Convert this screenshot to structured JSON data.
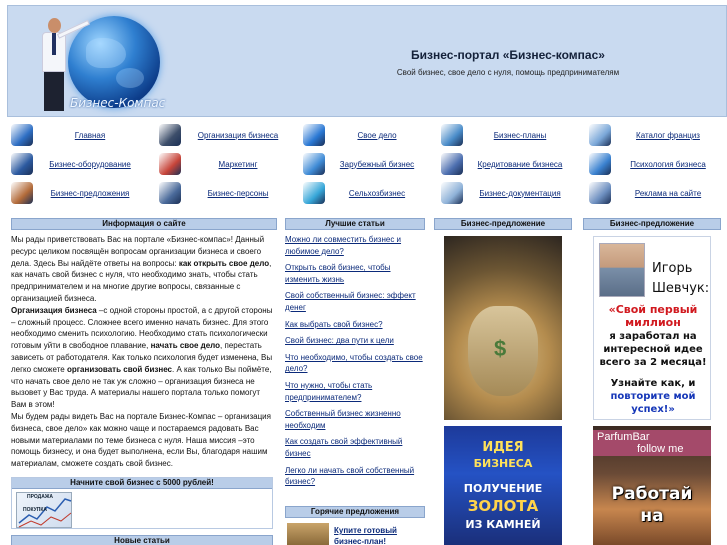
{
  "header": {
    "logo_text": "Бизнес-Компас",
    "title": "Бизнес-портал «Бизнес-компас»",
    "subtitle": "Свой бизнес, свое дело с нуля, помощь предпринимателям"
  },
  "nav": {
    "items": [
      {
        "label": "Главная",
        "icon": "globe-icon",
        "color": "#2f6fc4"
      },
      {
        "label": "Организация бизнеса",
        "icon": "laptop-icon",
        "color": "#3d4e6a"
      },
      {
        "label": "Свое дело",
        "icon": "briefcase-icon",
        "color": "#2a78d4"
      },
      {
        "label": "Бизнес-планы",
        "icon": "calculator-icon",
        "color": "#4a8cc9"
      },
      {
        "label": "Каталог франциз",
        "icon": "catalog-icon",
        "color": "#7aa7d8"
      },
      {
        "label": "Бизнес-оборудование",
        "icon": "equipment-icon",
        "color": "#2c5aa0"
      },
      {
        "label": "Маркетинг",
        "icon": "chart-icon",
        "color": "#c7453a"
      },
      {
        "label": "Зарубежный бизнес",
        "icon": "compass-icon",
        "color": "#3f8bd6"
      },
      {
        "label": "Кредитование бизнеса",
        "icon": "credit-card-icon",
        "color": "#4d6fb0"
      },
      {
        "label": "Психология бизнеса",
        "icon": "question-icon",
        "color": "#3b82d0"
      },
      {
        "label": "Бизнес-предложения",
        "icon": "handshake-icon",
        "color": "#b36b3a"
      },
      {
        "label": "Бизнес-персоны",
        "icon": "magnifier-icon",
        "color": "#4a6a9a"
      },
      {
        "label": "Сельхозбизнес",
        "icon": "flower-icon",
        "color": "#36a6d8"
      },
      {
        "label": "Бизнес-документация",
        "icon": "document-icon",
        "color": "#8fb2d8"
      },
      {
        "label": "Реклама на сайте",
        "icon": "envelope-icon",
        "color": "#6d8fc0"
      }
    ]
  },
  "columns": {
    "info_title": "Информация о сайте",
    "best_title": "Лучшие статьи",
    "offer_title_1": "Бизнес-предложение",
    "offer_title_2": "Бизнес-предложение"
  },
  "info": {
    "p1": "Мы рады приветствовать Вас на портале «Бизнес-компас»! Данный ресурс целиком посвящён вопросам организации бизнеса и своего дела. Здесь Вы найдёте ответы на вопросы:",
    "p1_bold": "как открыть свое дело",
    "p1_rest": ", как начать свой бизнес с нуля, что необходимо знать, чтобы стать предпринимателем и на многие другие вопросы, связанные с организацией бизнеса.",
    "p2_bold": "Организация бизнеса",
    "p2": " –с одной стороны простой, а с другой стороны – сложный процесс. Сложнее всего именно начать бизнес. Для этого необходимо сменить психологию. Необходимо стать психологически готовым уйти в свободное плавание,",
    "p2_bold2": "начать свое дело",
    "p2_rest": ", перестать зависеть от работодателя. Как только психология будет изменена, Вы легко сможете",
    "p2_bold3": "организовать свой бизнес",
    "p2_end": ". А как только Вы поймёте, что начать свое дело не так уж сложно – организация бизнеса не вызовет у Вас труда. А материалы нашего портала только помогут Вам в этом!",
    "p3": "Мы будем рады видеть Вас на портале   Бизнес-Компас   – организация бизнеса, свое дело» как можно чаще и постараемся радовать Вас новыми материалами по теме бизнеса с нуля. Наша миссия  –это помощь бизнесу, и она будет выполнена, если Вы, благодаря нашим материалам, сможете создать свой бизнес."
  },
  "start_box": {
    "title": "Начните свой бизнес с 5000 рублей!",
    "chart_label_top": "ПРОДАЖА",
    "chart_label_bottom": "ПОКУПКА"
  },
  "new_articles_title": "Новые статьи",
  "best_articles": [
    "Можно ли совместить бизнес и любимое дело?",
    "Открыть свой бизнес, чтобы изменить жизнь",
    "Свой собственный бизнес: эффект денег",
    "Как выбрать свой бизнес?",
    "Свой бизнес: два пути к цели",
    "Что необходимо, чтобы создать свое дело?",
    "Что нужно, чтобы стать предпринимателем?",
    "Собственный бизнес жизненно необходим",
    "Как создать свой эффективный бизнес",
    "Легко ли начать свой собственный бизнес?"
  ],
  "hot_offers": {
    "title": "Горячие предложения",
    "link": "Купите готовый бизнес-план!"
  },
  "ads": {
    "idea": {
      "l1": "ИДЕЯ",
      "l2": "БИЗНЕСА",
      "l3": "ПОЛУЧЕНИЕ",
      "l4": "ЗОЛОТА",
      "l5": "ИЗ КАМНЕЙ"
    },
    "igor": {
      "name1": "Игорь",
      "name2": "Шевчук:",
      "red": "«Свой первый миллион",
      "black": "я заработал на интересной идее всего за 2 месяца!",
      "black2": "Узнайте как, и",
      "blue": "повторите мой успех!»"
    },
    "parfum": {
      "logo1": "ParfumBar",
      "logo2": "follow me",
      "big1": "Работай",
      "big2": "на"
    }
  }
}
